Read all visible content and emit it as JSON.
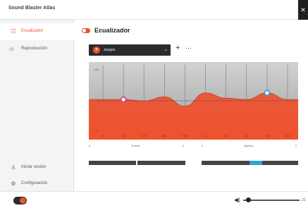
{
  "app": {
    "title": "Sound Blaster Atlas",
    "close_glyph": "✕"
  },
  "sidebar": {
    "items": [
      {
        "label": "Ecualizador",
        "icon": "equalizer-icon",
        "glyph": "☷",
        "active": true
      },
      {
        "label": "Reproducción",
        "icon": "speaker-icon",
        "glyph": "◁))",
        "active": false
      }
    ],
    "bottom": [
      {
        "label": "Iniciar sesión",
        "icon": "user-icon",
        "glyph": "♙"
      },
      {
        "label": "Configuración",
        "icon": "gear-icon",
        "glyph": "⚙"
      }
    ]
  },
  "main": {
    "title": "Ecualizador",
    "preset": {
      "name": "Juegos",
      "icon": "gamepad-icon",
      "glyph": "✦"
    },
    "add_glyph": "+",
    "more_glyph": "···"
  },
  "eq": {
    "y_labels": [
      "+12",
      "0",
      "-12"
    ],
    "x_labels": [
      "31",
      "62",
      "125",
      "250",
      "500",
      "1k",
      "2k",
      "4k",
      "8k",
      "16k"
    ],
    "gains": [
      0.5,
      0.5,
      0,
      1.5,
      -2,
      3,
      1,
      0.5,
      3,
      0.5
    ],
    "selected_bands": [
      1,
      8
    ],
    "colors": {
      "curve": "#f0522c",
      "curve_top": "#e9583a",
      "handle_left": "#d63b8a",
      "handle_right": "#2aa8c4"
    }
  },
  "sliders": {
    "bass": {
      "label": "Graves",
      "min": "0",
      "max": "0"
    },
    "treble": {
      "label": "Agudos",
      "min": "0",
      "max": "0"
    }
  },
  "footer": {
    "volume_value": "21",
    "volume_level": 0.05,
    "speaker_glyph": "◀)"
  }
}
